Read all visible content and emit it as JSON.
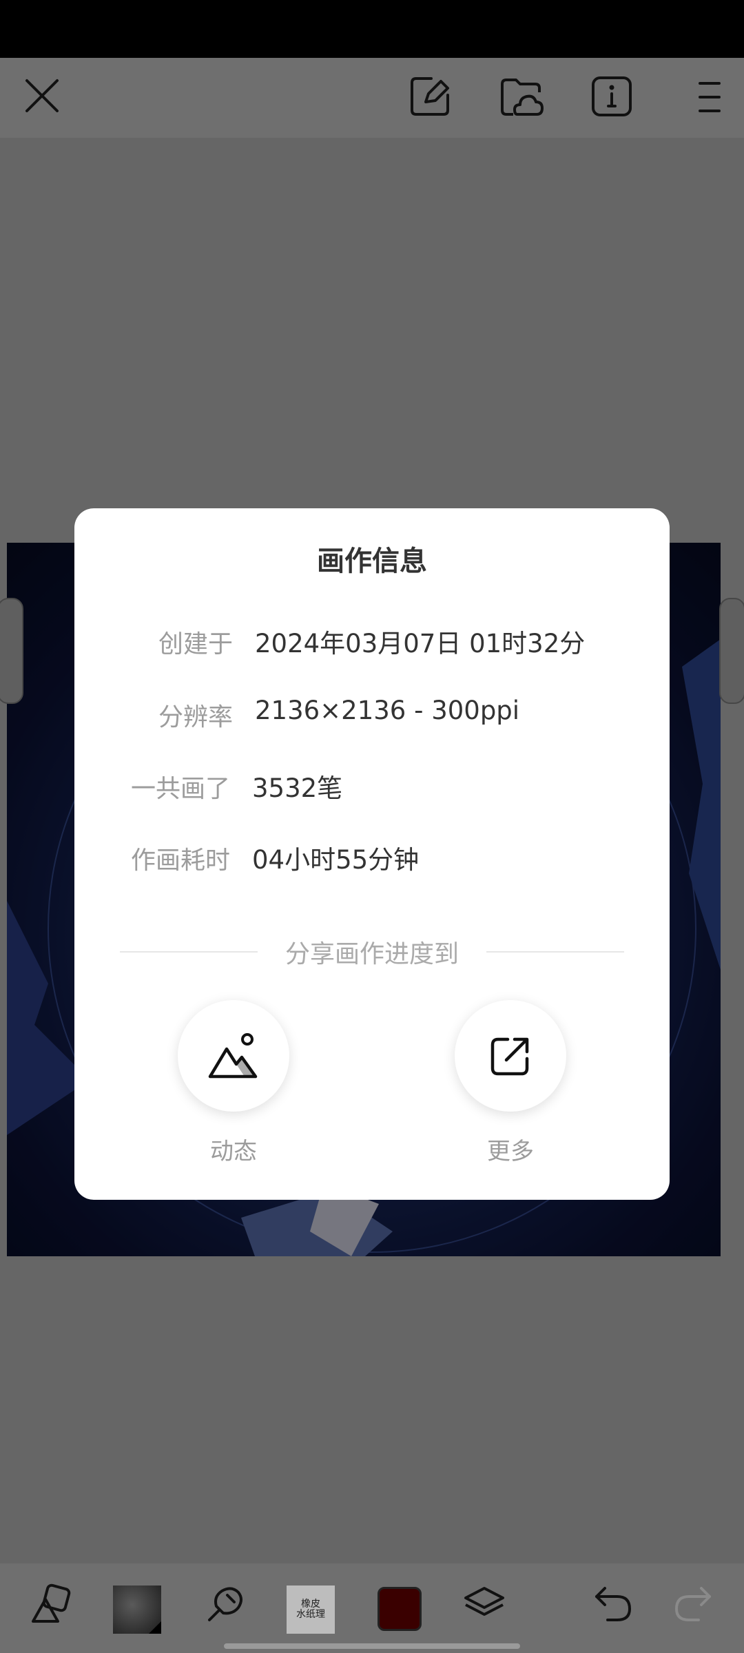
{
  "dialog": {
    "title": "画作信息",
    "rows": [
      {
        "label": "创建于",
        "value": "2024年03月07日 01时32分"
      },
      {
        "label": "分辨率",
        "value": "2136×2136 - 300ppi"
      },
      {
        "label": "一共画了",
        "value": "3532笔"
      },
      {
        "label": "作画耗时",
        "value": "04小时55分钟"
      }
    ],
    "share_label": "分享画作进度到",
    "share_options": [
      {
        "label": "动态",
        "icon": "mountain-photo-icon"
      },
      {
        "label": "更多",
        "icon": "external-share-icon"
      }
    ]
  },
  "toolbar_top": {
    "icons": [
      "close-icon",
      "edit-canvas-icon",
      "cloud-folder-icon",
      "info-icon",
      "menu-icon"
    ]
  },
  "toolbar_bottom": {
    "tools": [
      "shape-tool-icon",
      "brush-texture-thumbnail",
      "brush-tool-icon",
      "paper-texture-thumbnail",
      "color-swatch",
      "layers-icon",
      "undo-icon",
      "redo-icon"
    ],
    "paper_texture_text": "橡皮\n水纸理",
    "current_color": "#3a0000"
  }
}
